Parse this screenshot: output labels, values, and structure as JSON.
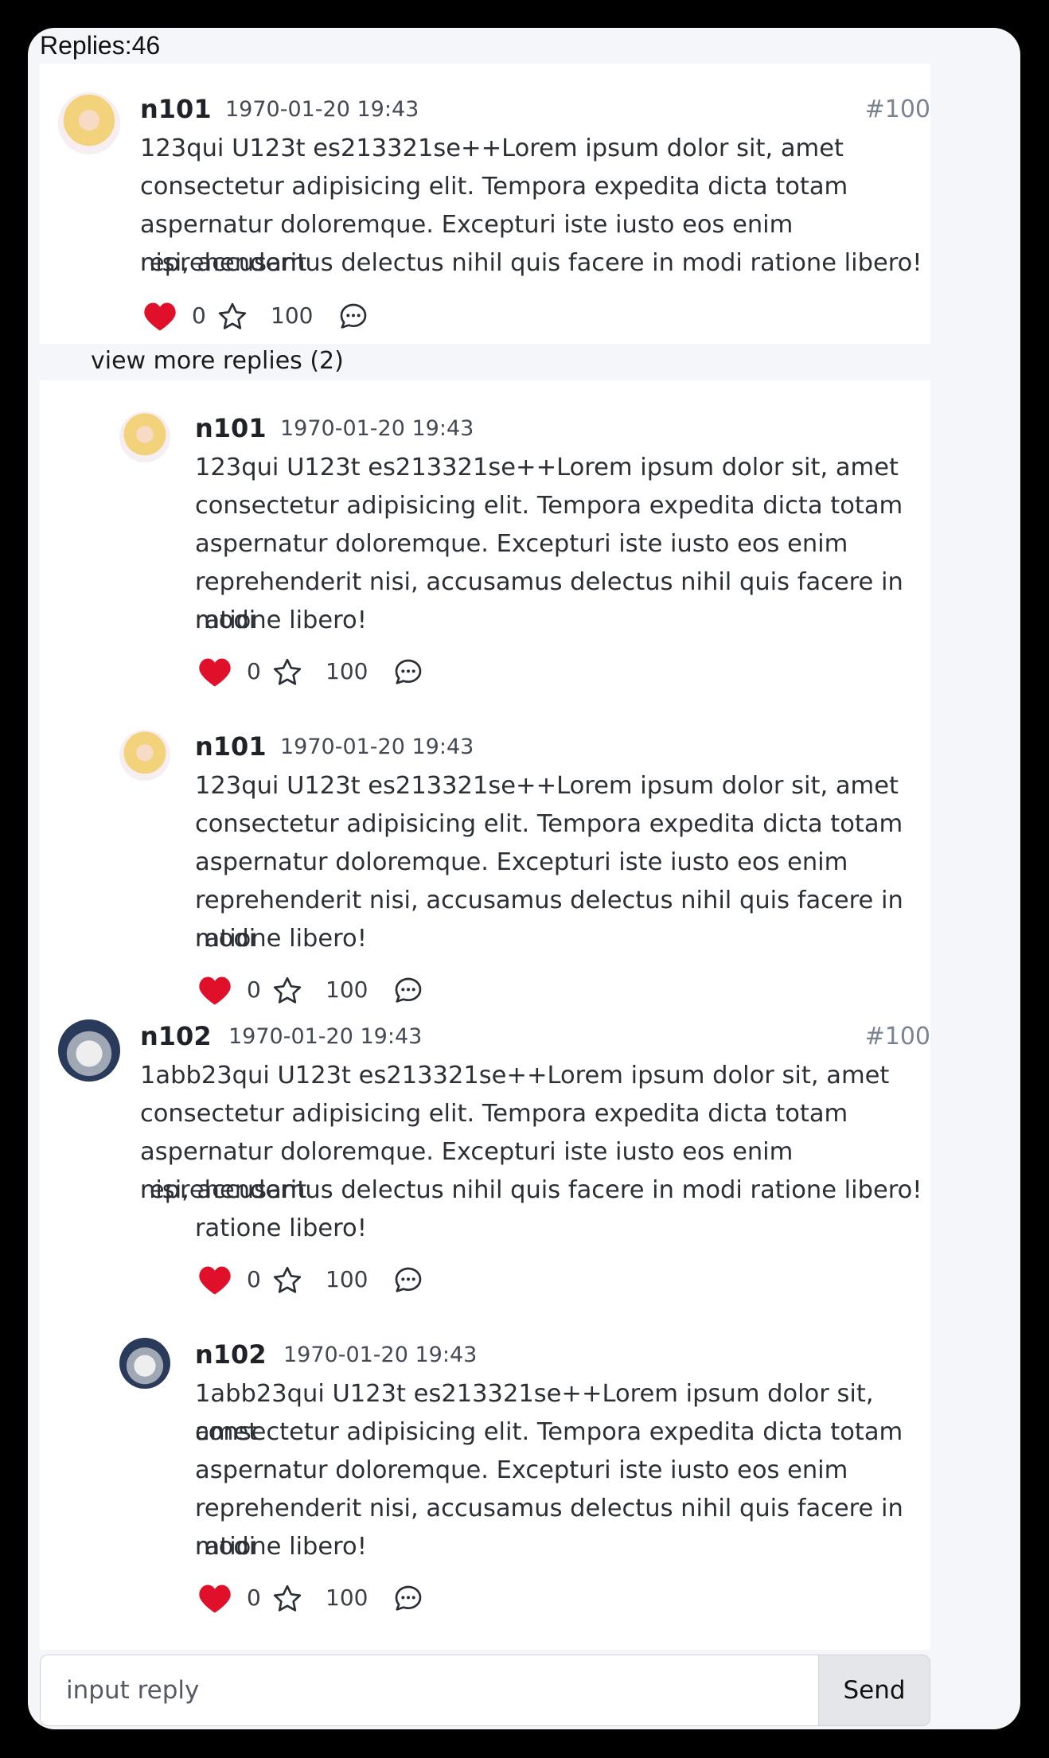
{
  "header": {
    "replies_label": "Replies:46"
  },
  "comments": [
    {
      "username": "n101",
      "time": "1970-01-20 19:43",
      "floor": "#100",
      "lines": [
        "123qui U123t es213321se++Lorem ipsum dolor sit, amet",
        "consectetur adipisicing elit. Tempora expedita dicta totam",
        "aspernatur doloremque. Excepturi iste iusto eos enim reprehenderit",
        "nisi, accusamus delectus nihil quis facere in modi ratione libero!"
      ],
      "likes": "0",
      "stars": "100"
    },
    {
      "username": "n102",
      "time": "1970-01-20 19:43",
      "floor": "#100",
      "lines": [
        "1abb23qui U123t es213321se++Lorem ipsum dolor sit, amet",
        "consectetur adipisicing elit. Tempora expedita dicta totam",
        "aspernatur doloremque. Excepturi iste iusto eos enim reprehenderit",
        "nisi, accusamus delectus nihil quis facere in modi ratione libero!",
        "ratione libero!"
      ],
      "likes": "0",
      "stars": "100"
    }
  ],
  "view_more": "view more replies (2)",
  "replies": [
    {
      "username": "n101",
      "time": "1970-01-20 19:43",
      "lines": [
        "123qui U123t es213321se++Lorem ipsum dolor sit, amet",
        "consectetur adipisicing elit. Tempora expedita dicta totam",
        "aspernatur doloremque. Excepturi iste iusto eos enim",
        "reprehenderit nisi, accusamus delectus nihil quis facere in modi",
        "ratione libero!"
      ],
      "likes": "0",
      "stars": "100"
    },
    {
      "username": "n101",
      "time": "1970-01-20 19:43",
      "lines": [
        "123qui U123t es213321se++Lorem ipsum dolor sit, amet",
        "consectetur adipisicing elit. Tempora expedita dicta totam",
        "aspernatur doloremque. Excepturi iste iusto eos enim",
        "reprehenderit nisi, accusamus delectus nihil quis facere in modi",
        "ratione libero!"
      ],
      "likes": "0",
      "stars": "100"
    },
    {
      "username": "n102",
      "time": "1970-01-20 19:43",
      "lines": [
        "1abb23qui U123t es213321se++Lorem ipsum dolor sit, amet",
        "consectetur adipisicing elit. Tempora expedita dicta totam",
        "aspernatur doloremque. Excepturi iste iusto eos enim",
        "reprehenderit nisi, accusamus delectus nihil quis facere in modi",
        "ratione libero!"
      ],
      "likes": "0",
      "stars": "100"
    }
  ],
  "reply_box": {
    "placeholder": "input reply",
    "send_label": "Send"
  },
  "icons": {
    "like": "heart-icon",
    "star": "star-icon",
    "reply": "comment-icon"
  },
  "colors": {
    "like": "#e0102a",
    "floor": "#7a8391",
    "panel": "#f4f6f9"
  }
}
